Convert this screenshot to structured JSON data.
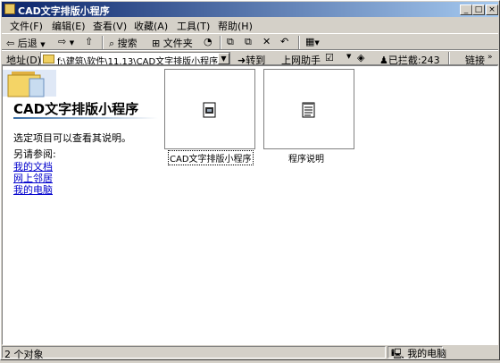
{
  "window": {
    "title": "CAD文字排版小程序"
  },
  "title_buttons": {
    "minimize": "_",
    "maximize": "□",
    "close": "×"
  },
  "menu": [
    "文件(F)",
    "编辑(E)",
    "查看(V)",
    "收藏(A)",
    "工具(T)",
    "帮助(H)"
  ],
  "toolbar": {
    "back_label": "后退",
    "search_label": "搜索",
    "folders_label": "文件夹"
  },
  "address_bar": {
    "label": "地址(D)",
    "value": "f:\\建筑\\软件\\11.13\\CAD文字排版小程序",
    "go_label": "转到",
    "online_help": "上网助手",
    "blocked": "已拦截:243",
    "links": "链接"
  },
  "left_pane": {
    "title": "CAD文字排版小程序",
    "hint": "选定项目可以查看其说明。",
    "see_also_label": "另请参阅:",
    "links": [
      "我的文档",
      "网上邻居",
      "我的电脑"
    ]
  },
  "items": [
    {
      "label": "CAD文字排版小程序",
      "icon": "program-icon",
      "selected": true
    },
    {
      "label": "程序说明",
      "icon": "document-icon",
      "selected": false
    }
  ],
  "status": {
    "count": "2 个对象",
    "location": "我的电脑"
  },
  "colors": {
    "title_start": "#0a246a",
    "title_end": "#a6caf0",
    "link": "#0000cc",
    "chrome": "#d4d0c8"
  }
}
